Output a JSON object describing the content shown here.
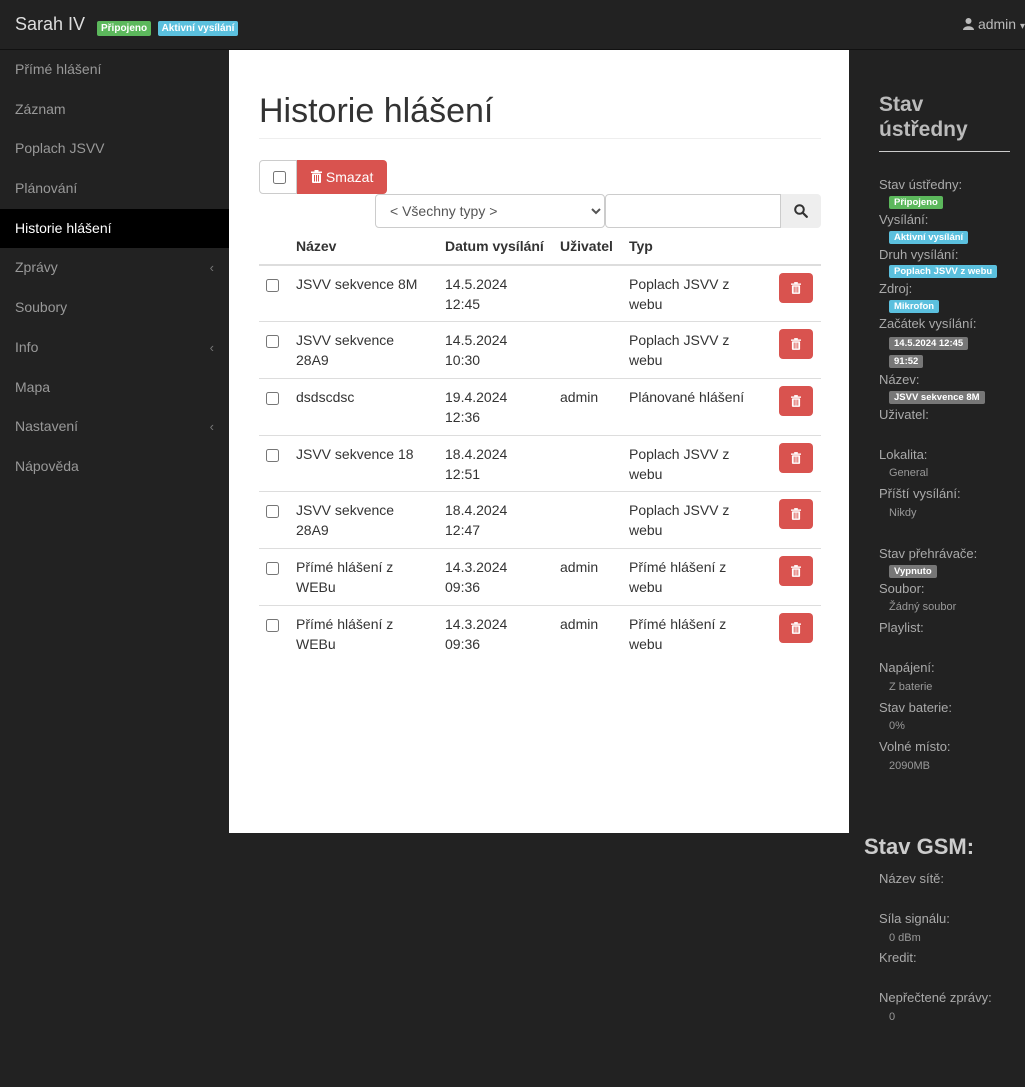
{
  "navbar": {
    "brand": "Sarah IV",
    "badge_connected": "Připojeno",
    "badge_broadcast": "Aktivní vysílání",
    "user": "admin"
  },
  "sidebar": {
    "items": [
      {
        "label": "Přímé hlášení"
      },
      {
        "label": "Záznam"
      },
      {
        "label": "Poplach JSVV"
      },
      {
        "label": "Plánování"
      },
      {
        "label": "Historie hlášení"
      },
      {
        "label": "Zprávy"
      },
      {
        "label": "Soubory"
      },
      {
        "label": "Info"
      },
      {
        "label": "Mapa"
      },
      {
        "label": "Nastavení"
      },
      {
        "label": "Nápověda"
      }
    ]
  },
  "main": {
    "title": "Historie hlášení",
    "delete_label": "Smazat",
    "filter_selected": "< Všechny typy >",
    "search_value": "",
    "columns": {
      "name": "Název",
      "date": "Datum vysílání",
      "user": "Uživatel",
      "type": "Typ"
    },
    "rows": [
      {
        "name": "JSVV sekvence 8M",
        "date": "14.5.2024",
        "time": "12:45",
        "user": "",
        "type": "Poplach JSVV z webu"
      },
      {
        "name": "JSVV sekvence 28A9",
        "date": "14.5.2024",
        "time": "10:30",
        "user": "",
        "type": "Poplach JSVV z webu"
      },
      {
        "name": "dsdscdsc",
        "date": "19.4.2024",
        "time": "12:36",
        "user": "admin",
        "type": "Plánované hlášení"
      },
      {
        "name": "JSVV sekvence 18",
        "date": "18.4.2024",
        "time": "12:51",
        "user": "",
        "type": "Poplach JSVV z webu"
      },
      {
        "name": "JSVV sekvence 28A9",
        "date": "18.4.2024",
        "time": "12:47",
        "user": "",
        "type": "Poplach JSVV z webu"
      },
      {
        "name": "Přímé hlášení z WEBu",
        "date": "14.3.2024",
        "time": "09:36",
        "user": "admin",
        "type": "Přímé hlášení z webu"
      },
      {
        "name": "Přímé hlášení z WEBu",
        "date": "14.3.2024",
        "time": "09:36",
        "user": "admin",
        "type": "Přímé hlášení z webu"
      }
    ]
  },
  "status": {
    "title_line1": "Stav",
    "title_line2": "ústředny",
    "central_label": "Stav ústředny:",
    "central_value": "Připojeno",
    "broadcast_label": "Vysílání:",
    "broadcast_value": "Aktivní vysílání",
    "broadcast_type_label": "Druh vysílání:",
    "broadcast_type_value": "Poplach JSVV z webu",
    "source_label": "Zdroj:",
    "source_value": "Mikrofon",
    "start_label": "Začátek vysílání:",
    "start_value": "14.5.2024 12:45",
    "duration_value": "91:52",
    "name_label": "Název:",
    "name_value": "JSVV sekvence 8M",
    "user_label": "Uživatel:",
    "locality_label": "Lokalita:",
    "locality_value": "General",
    "next_label": "Příští vysílání:",
    "next_value": "Nikdy",
    "player_label": "Stav přehrávače:",
    "player_value": "Vypnuto",
    "file_label": "Soubor:",
    "file_value": "Žádný soubor",
    "playlist_label": "Playlist:",
    "power_label": "Napájení:",
    "power_value": "Z baterie",
    "battery_label": "Stav baterie:",
    "battery_value": "0%",
    "space_label": "Volné místo:",
    "space_value": "2090MB"
  },
  "gsm": {
    "title": "Stav GSM:",
    "network_label": "Název sítě:",
    "signal_label": "Síla signálu:",
    "signal_value": "0 dBm",
    "credit_label": "Kredit:",
    "unread_label": "Nepřečtené zprávy:",
    "unread_value": "0"
  },
  "colors": {
    "success": "#5cb85c",
    "info": "#5bc0de",
    "danger": "#d9534f",
    "default": "#777777"
  }
}
